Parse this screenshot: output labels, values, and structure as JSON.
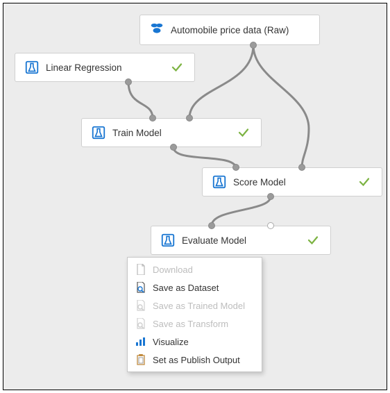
{
  "nodes": {
    "data": {
      "label": "Automobile price data (Raw)"
    },
    "lr": {
      "label": "Linear Regression"
    },
    "train": {
      "label": "Train Model"
    },
    "score": {
      "label": "Score Model"
    },
    "eval": {
      "label": "Evaluate Model"
    }
  },
  "menu": {
    "download": "Download",
    "saveDataset": "Save as Dataset",
    "saveTrained": "Save as Trained Model",
    "saveTransform": "Save as Transform",
    "visualize": "Visualize",
    "publish": "Set as Publish Output"
  }
}
